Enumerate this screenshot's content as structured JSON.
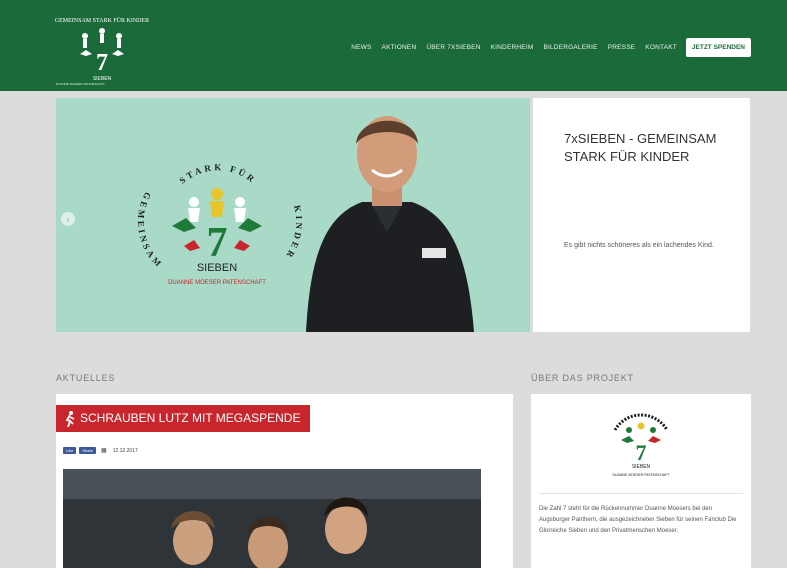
{
  "header": {
    "logo_tagline": "DUANNE MOESER PATENSCHAFT",
    "nav": [
      "NEWS",
      "AKTIONEN",
      "ÜBER 7XSIEBEN",
      "KINDERHEIM",
      "BILDERGALERIE",
      "PRESSE",
      "KONTAKT"
    ],
    "donate_label": "JETZT SPENDEN",
    "brand_color": "#1b6b3a"
  },
  "hero": {
    "logo_arc_top": "STARK FÜR",
    "logo_arc_left": "GEMEINSAM",
    "logo_arc_right": "KINDER",
    "logo_number": "7",
    "logo_word": "SIEBEN",
    "logo_tagline": "DUANNE MOESER PATENSCHAFT",
    "title": "7xSIEBEN - GEMEINSAM STARK FÜR KINDER",
    "subtitle": "Es gibt nichts schöneres als ein lachendes Kind.",
    "prev_icon": "chevron-left-icon"
  },
  "news": {
    "section_label": "AKTUELLES",
    "title": "SCHRAUBEN LUTZ MIT MEGASPENDE",
    "like_label": "Like",
    "share_label": "Share",
    "date": "12.12.2017",
    "accent_color": "#c9252c"
  },
  "project": {
    "section_label": "ÜBER DAS PROJEKT",
    "logo_word": "SIEBEN",
    "logo_tagline": "DUANNE MOESER PATENSCHAFT",
    "text": "Die Zahl 7 steht für die Rückennummer Duanne Moesers bei den Augsburger Panthern, die ausgezeichneten Sieben für seinen Fanclub Die Glorreiche Sieben und den Privatmenschen Moeser."
  }
}
